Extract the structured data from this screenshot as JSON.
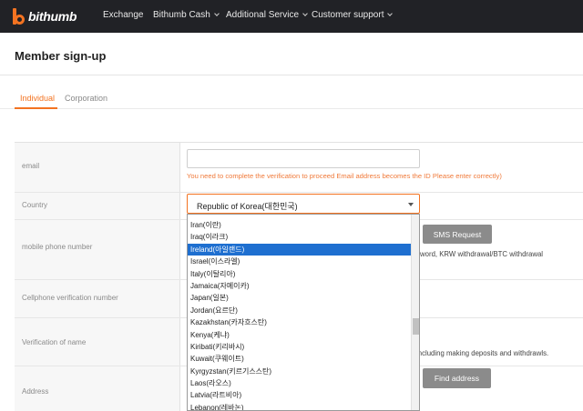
{
  "nav": {
    "logo_text": "bithumb",
    "items": [
      {
        "label": "Exchange",
        "has_menu": false
      },
      {
        "label": "Bithumb Cash",
        "has_menu": true
      },
      {
        "label": "Additional Service",
        "has_menu": true
      },
      {
        "label": "Customer support",
        "has_menu": true
      }
    ]
  },
  "page": {
    "title": "Member sign-up"
  },
  "tabs": [
    {
      "label": "Individual",
      "active": true
    },
    {
      "label": "Corporation",
      "active": false
    }
  ],
  "form": {
    "labels": {
      "email": "email",
      "country": "Country",
      "mobile": "mobile phone number",
      "verification": "Cellphone verification number",
      "name": "Verification of name",
      "address": "Address"
    },
    "email_value": "",
    "email_note": "You need to complete the verification to proceed Email address becomes the ID Please enter correctly)",
    "country_value": "Republic of Korea(대한민국)",
    "sms_button": "SMS Request",
    "phone_note": "word, KRW withdrawal/BTC withdrawal",
    "name_note": "including making deposits and withdrawls.",
    "find_address_button": "Find address"
  },
  "dropdown": {
    "items": [
      {
        "label": "Iran(이란)",
        "selected": false
      },
      {
        "label": "Iraq(이라크)",
        "selected": false
      },
      {
        "label": "Ireland(아일랜드)",
        "selected": true
      },
      {
        "label": "Israel(이스라엘)",
        "selected": false
      },
      {
        "label": "Italy(이탈리아)",
        "selected": false
      },
      {
        "label": "Jamaica(자메이카)",
        "selected": false
      },
      {
        "label": "Japan(일본)",
        "selected": false
      },
      {
        "label": "Jordan(요르단)",
        "selected": false
      },
      {
        "label": "Kazakhstan(카자흐스탄)",
        "selected": false
      },
      {
        "label": "Kenya(케냐)",
        "selected": false
      },
      {
        "label": "Kiribati(키리바시)",
        "selected": false
      },
      {
        "label": "Kuwait(쿠웨이트)",
        "selected": false
      },
      {
        "label": "Kyrgyzstan(키르기스스탄)",
        "selected": false
      },
      {
        "label": "Laos(라오스)",
        "selected": false
      },
      {
        "label": "Latvia(라트비아)",
        "selected": false
      },
      {
        "label": "Lebanon(레바논)",
        "selected": false
      }
    ]
  },
  "colors": {
    "accent": "#f37321",
    "nav_bg": "#212226",
    "selected_bg": "#1e6fd0",
    "button_bg": "#8b8b8b",
    "note_orange": "#f07a3a"
  }
}
